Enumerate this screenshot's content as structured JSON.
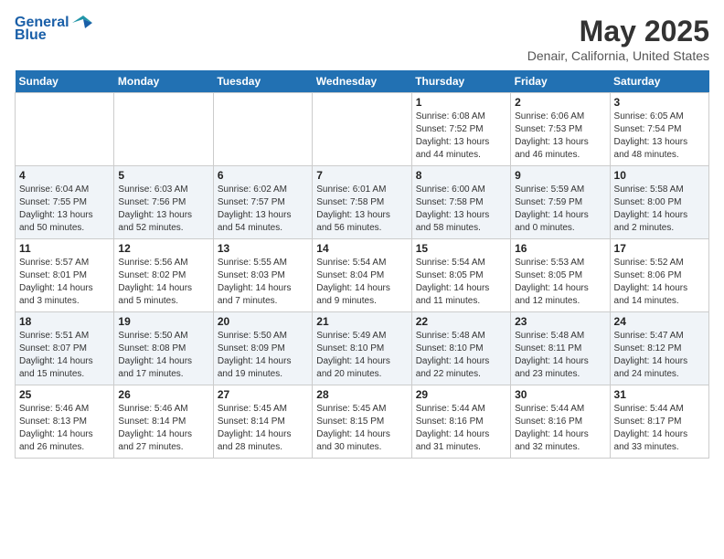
{
  "header": {
    "logo_line1": "General",
    "logo_line2": "Blue",
    "month_year": "May 2025",
    "location": "Denair, California, United States"
  },
  "days_of_week": [
    "Sunday",
    "Monday",
    "Tuesday",
    "Wednesday",
    "Thursday",
    "Friday",
    "Saturday"
  ],
  "weeks": [
    [
      {
        "day": "",
        "info": ""
      },
      {
        "day": "",
        "info": ""
      },
      {
        "day": "",
        "info": ""
      },
      {
        "day": "",
        "info": ""
      },
      {
        "day": "1",
        "info": "Sunrise: 6:08 AM\nSunset: 7:52 PM\nDaylight: 13 hours\nand 44 minutes."
      },
      {
        "day": "2",
        "info": "Sunrise: 6:06 AM\nSunset: 7:53 PM\nDaylight: 13 hours\nand 46 minutes."
      },
      {
        "day": "3",
        "info": "Sunrise: 6:05 AM\nSunset: 7:54 PM\nDaylight: 13 hours\nand 48 minutes."
      }
    ],
    [
      {
        "day": "4",
        "info": "Sunrise: 6:04 AM\nSunset: 7:55 PM\nDaylight: 13 hours\nand 50 minutes."
      },
      {
        "day": "5",
        "info": "Sunrise: 6:03 AM\nSunset: 7:56 PM\nDaylight: 13 hours\nand 52 minutes."
      },
      {
        "day": "6",
        "info": "Sunrise: 6:02 AM\nSunset: 7:57 PM\nDaylight: 13 hours\nand 54 minutes."
      },
      {
        "day": "7",
        "info": "Sunrise: 6:01 AM\nSunset: 7:58 PM\nDaylight: 13 hours\nand 56 minutes."
      },
      {
        "day": "8",
        "info": "Sunrise: 6:00 AM\nSunset: 7:58 PM\nDaylight: 13 hours\nand 58 minutes."
      },
      {
        "day": "9",
        "info": "Sunrise: 5:59 AM\nSunset: 7:59 PM\nDaylight: 14 hours\nand 0 minutes."
      },
      {
        "day": "10",
        "info": "Sunrise: 5:58 AM\nSunset: 8:00 PM\nDaylight: 14 hours\nand 2 minutes."
      }
    ],
    [
      {
        "day": "11",
        "info": "Sunrise: 5:57 AM\nSunset: 8:01 PM\nDaylight: 14 hours\nand 3 minutes."
      },
      {
        "day": "12",
        "info": "Sunrise: 5:56 AM\nSunset: 8:02 PM\nDaylight: 14 hours\nand 5 minutes."
      },
      {
        "day": "13",
        "info": "Sunrise: 5:55 AM\nSunset: 8:03 PM\nDaylight: 14 hours\nand 7 minutes."
      },
      {
        "day": "14",
        "info": "Sunrise: 5:54 AM\nSunset: 8:04 PM\nDaylight: 14 hours\nand 9 minutes."
      },
      {
        "day": "15",
        "info": "Sunrise: 5:54 AM\nSunset: 8:05 PM\nDaylight: 14 hours\nand 11 minutes."
      },
      {
        "day": "16",
        "info": "Sunrise: 5:53 AM\nSunset: 8:05 PM\nDaylight: 14 hours\nand 12 minutes."
      },
      {
        "day": "17",
        "info": "Sunrise: 5:52 AM\nSunset: 8:06 PM\nDaylight: 14 hours\nand 14 minutes."
      }
    ],
    [
      {
        "day": "18",
        "info": "Sunrise: 5:51 AM\nSunset: 8:07 PM\nDaylight: 14 hours\nand 15 minutes."
      },
      {
        "day": "19",
        "info": "Sunrise: 5:50 AM\nSunset: 8:08 PM\nDaylight: 14 hours\nand 17 minutes."
      },
      {
        "day": "20",
        "info": "Sunrise: 5:50 AM\nSunset: 8:09 PM\nDaylight: 14 hours\nand 19 minutes."
      },
      {
        "day": "21",
        "info": "Sunrise: 5:49 AM\nSunset: 8:10 PM\nDaylight: 14 hours\nand 20 minutes."
      },
      {
        "day": "22",
        "info": "Sunrise: 5:48 AM\nSunset: 8:10 PM\nDaylight: 14 hours\nand 22 minutes."
      },
      {
        "day": "23",
        "info": "Sunrise: 5:48 AM\nSunset: 8:11 PM\nDaylight: 14 hours\nand 23 minutes."
      },
      {
        "day": "24",
        "info": "Sunrise: 5:47 AM\nSunset: 8:12 PM\nDaylight: 14 hours\nand 24 minutes."
      }
    ],
    [
      {
        "day": "25",
        "info": "Sunrise: 5:46 AM\nSunset: 8:13 PM\nDaylight: 14 hours\nand 26 minutes."
      },
      {
        "day": "26",
        "info": "Sunrise: 5:46 AM\nSunset: 8:14 PM\nDaylight: 14 hours\nand 27 minutes."
      },
      {
        "day": "27",
        "info": "Sunrise: 5:45 AM\nSunset: 8:14 PM\nDaylight: 14 hours\nand 28 minutes."
      },
      {
        "day": "28",
        "info": "Sunrise: 5:45 AM\nSunset: 8:15 PM\nDaylight: 14 hours\nand 30 minutes."
      },
      {
        "day": "29",
        "info": "Sunrise: 5:44 AM\nSunset: 8:16 PM\nDaylight: 14 hours\nand 31 minutes."
      },
      {
        "day": "30",
        "info": "Sunrise: 5:44 AM\nSunset: 8:16 PM\nDaylight: 14 hours\nand 32 minutes."
      },
      {
        "day": "31",
        "info": "Sunrise: 5:44 AM\nSunset: 8:17 PM\nDaylight: 14 hours\nand 33 minutes."
      }
    ]
  ]
}
